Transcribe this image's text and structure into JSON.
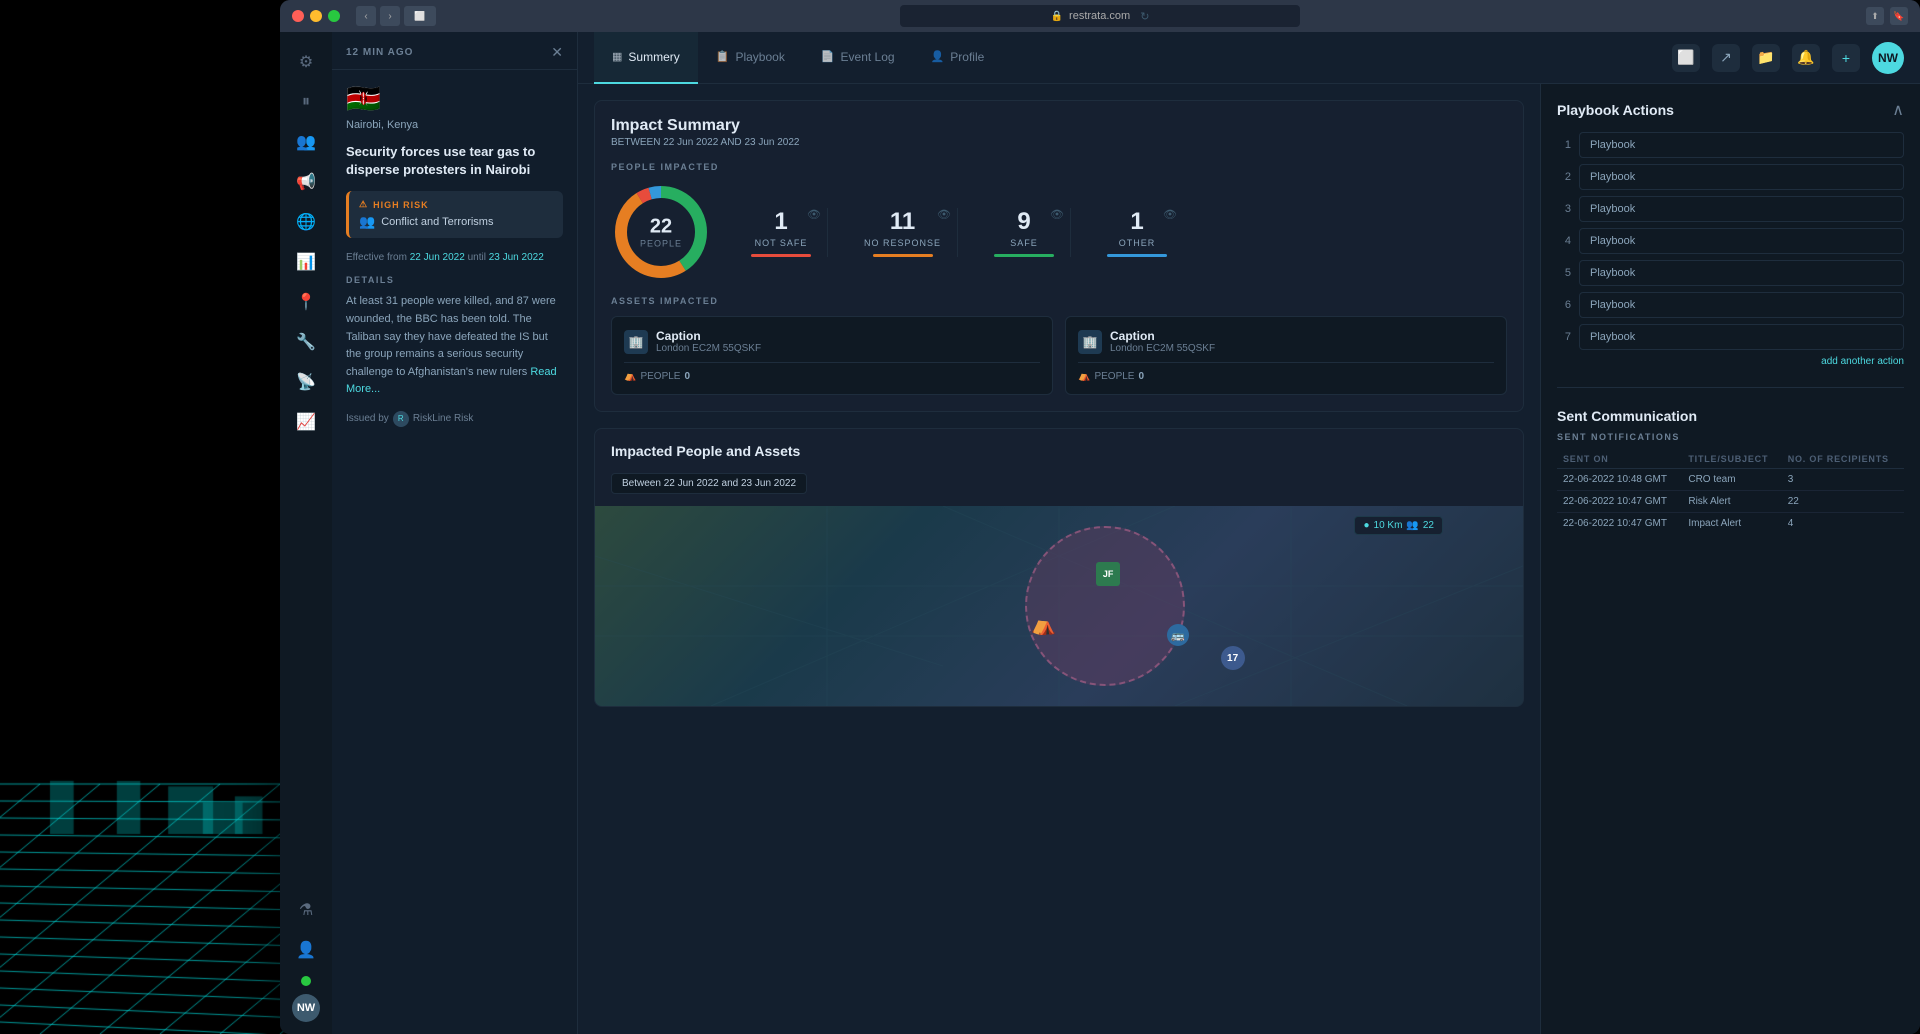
{
  "app": {
    "url": "restrata.com",
    "time_ago": "12 MIN AGO"
  },
  "sidebar": {
    "items": [
      {
        "id": "settings",
        "icon": "⚙",
        "active": false
      },
      {
        "id": "pause",
        "icon": "⏸",
        "active": false
      },
      {
        "id": "users",
        "icon": "👥",
        "active": false
      },
      {
        "id": "alert",
        "icon": "📢",
        "active": false
      },
      {
        "id": "network",
        "icon": "🌐",
        "active": false
      },
      {
        "id": "chart",
        "icon": "📊",
        "active": false
      },
      {
        "id": "location",
        "icon": "📍",
        "active": false
      },
      {
        "id": "tools",
        "icon": "🔧",
        "active": false
      },
      {
        "id": "radar",
        "icon": "📡",
        "active": false
      },
      {
        "id": "analytics",
        "icon": "📈",
        "active": false
      }
    ],
    "bottom": [
      {
        "id": "filters",
        "icon": "⚗"
      },
      {
        "id": "person",
        "icon": "👤"
      }
    ],
    "status": "online",
    "avatar_initials": "NW"
  },
  "alert": {
    "time_ago": "12 MIN AGO",
    "flag": "🇰🇪",
    "location": "Nairobi, Kenya",
    "title": "Security forces use tear gas to disperse protesters in Nairobi",
    "risk_level": "HIGH RISK",
    "risk_type": "Conflict and Terrorisms",
    "effective_from": "22 Jun 2022",
    "effective_until": "23 Jun 2022",
    "details_label": "DETAILS",
    "details_text": "At least 31 people were killed, and 87 were wounded, the BBC has been told. The Taliban say they have defeated the IS but the group remains a serious security challenge to Afghanistan's new rulers",
    "read_more": "Read More...",
    "issued_by": "Issued by",
    "issuer_name": "RiskLine Risk"
  },
  "tabs": [
    {
      "id": "summary",
      "label": "Summery",
      "active": true,
      "icon": "▦"
    },
    {
      "id": "playbook",
      "label": "Playbook",
      "active": false,
      "icon": "📋"
    },
    {
      "id": "event-log",
      "label": "Event Log",
      "active": false,
      "icon": "📄"
    },
    {
      "id": "profile",
      "label": "Profile",
      "active": false,
      "icon": "👤"
    }
  ],
  "top_nav_right": {
    "icons": [
      "copy",
      "share",
      "folder",
      "bell",
      "plus"
    ],
    "avatar": "NW"
  },
  "impact_summary": {
    "title": "Impact Summary",
    "between_label": "BETWEEN",
    "date_from": "22 Jun 2022",
    "and_label": "AND",
    "date_to": "23 Jun 2022",
    "people_impacted_label": "PEOPLE IMPACTED",
    "total_people": 22,
    "total_label": "PEOPLE",
    "stats": [
      {
        "number": 1,
        "label": "NOT SAFE",
        "color": "#e74c3c"
      },
      {
        "number": 11,
        "label": "NO RESPONSE",
        "color": "#e67e22"
      },
      {
        "number": 9,
        "label": "SAFE",
        "color": "#27ae60"
      },
      {
        "number": 1,
        "label": "OTHER",
        "color": "#3498db"
      }
    ],
    "assets_impacted_label": "ASSETS IMPACTED",
    "assets": [
      {
        "title": "Caption",
        "address": "London EC2M 55QSKF",
        "people": 0,
        "people_label": "PEOPLE"
      },
      {
        "title": "Caption",
        "address": "London EC2M 55QSKF",
        "people": 0,
        "people_label": "PEOPLE"
      }
    ]
  },
  "impacted_map": {
    "title": "Impacted People and Assets",
    "date_range": "Between 22 Jun 2022 and 23 Jun 2022",
    "km_badge": "10 Km",
    "count_badge": "22"
  },
  "playbook_actions": {
    "title": "Playbook Actions",
    "items": [
      {
        "num": 1,
        "label": "Playbook"
      },
      {
        "num": 2,
        "label": "Playbook"
      },
      {
        "num": 3,
        "label": "Playbook"
      },
      {
        "num": 4,
        "label": "Playbook"
      },
      {
        "num": 5,
        "label": "Playbook"
      },
      {
        "num": 6,
        "label": "Playbook"
      },
      {
        "num": 7,
        "label": "Playbook"
      }
    ],
    "add_action": "add another action"
  },
  "sent_communication": {
    "title": "Sent Communication",
    "notifications_label": "SENT NOTIFICATIONS",
    "columns": [
      "SENT ON",
      "TITLE/SUBJECT",
      "NO. OF RECIPIENTS"
    ],
    "rows": [
      {
        "sent_on": "22-06-2022 10:48 GMT",
        "title": "CRO team",
        "recipients": 3
      },
      {
        "sent_on": "22-06-2022 10:47 GMT",
        "title": "Risk Alert",
        "recipients": 22
      },
      {
        "sent_on": "22-06-2022 10:47 GMT",
        "title": "Impact Alert",
        "recipients": 4
      }
    ]
  }
}
